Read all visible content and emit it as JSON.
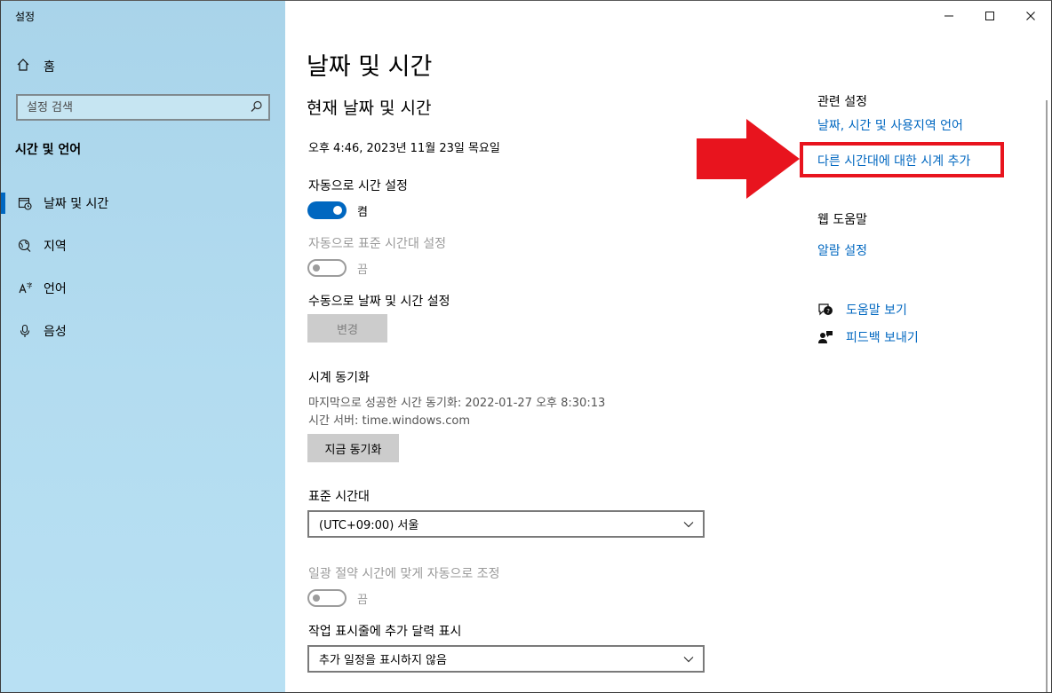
{
  "app_title": "설정",
  "sidebar": {
    "home_label": "홈",
    "search_placeholder": "설정 검색",
    "section_header": "시간 및 언어",
    "items": [
      {
        "label": "날짜 및 시간",
        "icon": "calendar-clock-icon"
      },
      {
        "label": "지역",
        "icon": "globe-icon"
      },
      {
        "label": "언어",
        "icon": "language-icon"
      },
      {
        "label": "음성",
        "icon": "microphone-icon"
      }
    ]
  },
  "window_controls": {
    "minimize": "—",
    "maximize": "☐",
    "close": "✕"
  },
  "main": {
    "title": "날짜 및 시간",
    "subtitle": "현재 날짜 및 시간",
    "current_datetime": "오후 4:46, 2023년 11월 23일 목요일",
    "auto_time_label": "자동으로 시간 설정",
    "auto_time_state": "켬",
    "auto_tz_label": "자동으로 표준 시간대 설정",
    "auto_tz_state": "끔",
    "manual_label": "수동으로 날짜 및 시간 설정",
    "change_button": "변경",
    "sync_label": "시계 동기화",
    "last_sync": "마지막으로 성공한 시간 동기화: 2022-01-27 오후 8:30:13",
    "time_server": "시간 서버: time.windows.com",
    "sync_button": "지금 동기화",
    "timezone_label": "표준 시간대",
    "timezone_value": "(UTC+09:00) 서울",
    "dst_label": "일광 절약 시간에 맞게 자동으로 조정",
    "dst_state": "끔",
    "calendar_label": "작업 표시줄에 추가 달력 표시",
    "calendar_value": "추가 일정을 표시하지 않음"
  },
  "related": {
    "header": "관련 설정",
    "link1": "날짜, 시간 및 사용지역 언어",
    "link2": "다른 시간대에 대한 시계 추가",
    "web_help": "웹 도움말",
    "alarm": "알람 설정",
    "get_help": "도움말 보기",
    "feedback": "피드백 보내기"
  },
  "colors": {
    "accent": "#0067c0",
    "highlight": "#e8141e"
  }
}
